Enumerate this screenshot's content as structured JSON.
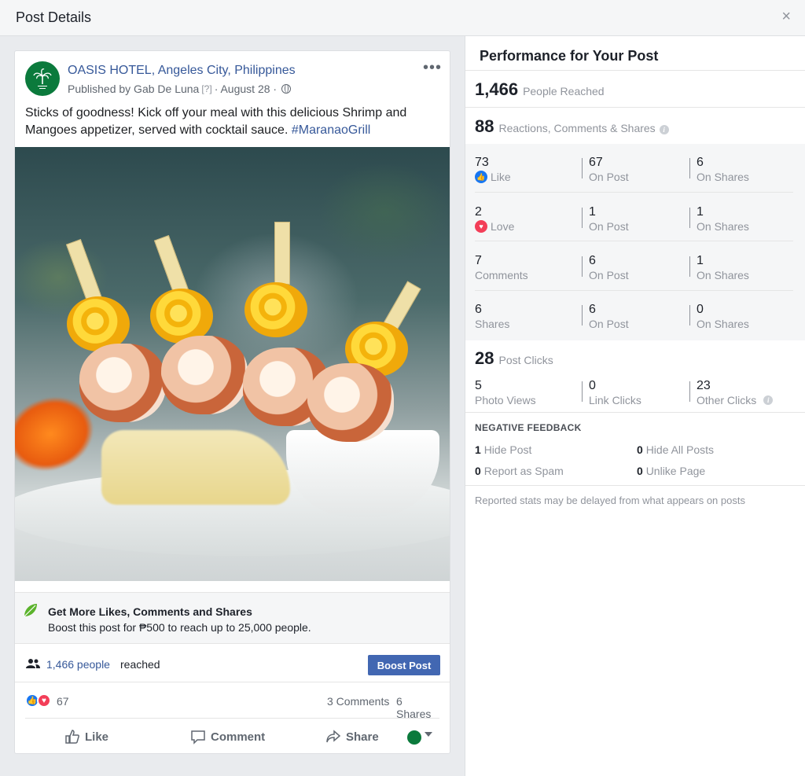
{
  "header": {
    "title": "Post Details",
    "close": "×"
  },
  "post": {
    "page_name": "OASIS HOTEL, Angeles City, Philippines",
    "published_by": "Published by Gab De Luna",
    "help_marker": "[?]",
    "date": "· August 28 ·",
    "more": "•••",
    "text": "Sticks of goodness! Kick off your meal with this delicious Shrimp and Mangoes appetizer, served with cocktail sauce. ",
    "hashtag": "#MaranaoGrill",
    "boost_title": "Get More Likes, Comments and Shares",
    "boost_subtitle": "Boost this post for ₱500 to reach up to 25,000 people.",
    "reach_link": "1,466 people",
    "reach_word": "reached",
    "boost_button": "Boost Post",
    "reactions_count": "67",
    "comments_count": "3 Comments",
    "shares_count": "6 Shares",
    "actions": {
      "like": "Like",
      "comment": "Comment",
      "share": "Share"
    }
  },
  "performance": {
    "title": "Performance for Your Post",
    "people_reached": {
      "value": "1,466",
      "label": "People Reached"
    },
    "reactions": {
      "value": "88",
      "label": "Reactions, Comments & Shares"
    },
    "breakdown": [
      {
        "total": "73",
        "label": "Like",
        "on_post": "67",
        "on_post_label": "On Post",
        "on_shares": "6",
        "on_shares_label": "On Shares"
      },
      {
        "total": "2",
        "label": "Love",
        "on_post": "1",
        "on_post_label": "On Post",
        "on_shares": "1",
        "on_shares_label": "On Shares"
      },
      {
        "total": "7",
        "label": "Comments",
        "on_post": "6",
        "on_post_label": "On Post",
        "on_shares": "1",
        "on_shares_label": "On Shares"
      },
      {
        "total": "6",
        "label": "Shares",
        "on_post": "6",
        "on_post_label": "On Post",
        "on_shares": "0",
        "on_shares_label": "On Shares"
      }
    ],
    "post_clicks": {
      "value": "28",
      "label": "Post Clicks"
    },
    "clicks": [
      {
        "value": "5",
        "label": "Photo Views"
      },
      {
        "value": "0",
        "label": "Link Clicks"
      },
      {
        "value": "23",
        "label": "Other Clicks"
      }
    ],
    "negative": {
      "title": "NEGATIVE FEEDBACK",
      "items": [
        {
          "value": "1",
          "label": "Hide Post"
        },
        {
          "value": "0",
          "label": "Hide All Posts"
        },
        {
          "value": "0",
          "label": "Report as Spam"
        },
        {
          "value": "0",
          "label": "Unlike Page"
        }
      ]
    },
    "note": "Reported stats may be delayed from what appears on posts"
  },
  "colors": {
    "link": "#365899",
    "boost_button": "#4267b2",
    "like": "#1877f2",
    "love": "#f33e58",
    "brand_avatar": "#0b7a3c"
  }
}
